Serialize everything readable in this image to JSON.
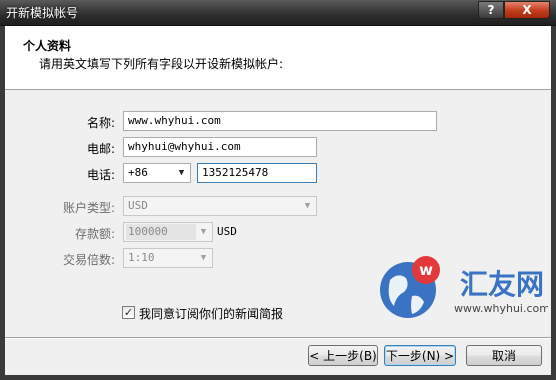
{
  "window": {
    "title": "开新模拟帐号",
    "help_glyph": "?",
    "close_glyph": "X"
  },
  "header": {
    "title": "个人资料",
    "subtitle": "请用英文填写下列所有字段以开设新模拟帐户:"
  },
  "form": {
    "name": {
      "label": "名称:",
      "value": "www.whyhui.com"
    },
    "email": {
      "label": "电邮:",
      "value": "whyhui@whyhui.com"
    },
    "phone": {
      "label": "电话:",
      "country_code": "+86",
      "number": "1352125478"
    },
    "account_type": {
      "label": "账户类型:",
      "value": "USD"
    },
    "deposit": {
      "label": "存款额:",
      "value": "100000",
      "unit": "USD"
    },
    "leverage": {
      "label": "交易倍数:",
      "value": "1:10"
    },
    "agree": {
      "label": "我同意订阅你们的新闻简报",
      "checked": true,
      "mark": "✓"
    }
  },
  "buttons": {
    "back": "< 上一步(B)",
    "next": "下一步(N) >",
    "cancel": "取消"
  },
  "watermark": {
    "logo_letter": "w",
    "brand": "汇友网",
    "url": "www.whyhui.com"
  },
  "colors": {
    "title_bar": "#2e2e2e",
    "close_button": "#c23b1c",
    "watermark_blue": "#3a73c4",
    "watermark_red": "#e23a3a"
  }
}
